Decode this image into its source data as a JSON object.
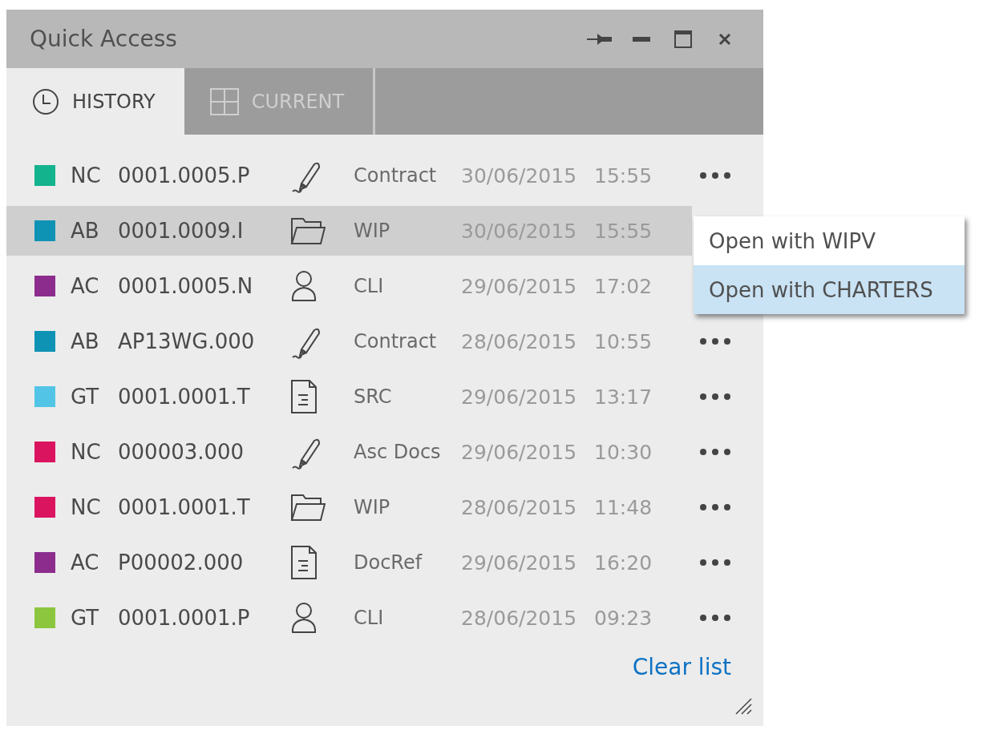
{
  "window": {
    "title": "Quick Access"
  },
  "tabs": [
    {
      "label": "HISTORY",
      "kind": "clock",
      "selected": true
    },
    {
      "label": "CURRENT",
      "kind": "grid",
      "selected": false
    }
  ],
  "rows": [
    {
      "color": "#13b38e",
      "prefix": "NC",
      "code": "0001.0005.P",
      "kind": "pen",
      "type": "Contract",
      "date": "30/06/2015",
      "time": "15:55",
      "selected": false
    },
    {
      "color": "#0f93b5",
      "prefix": "AB",
      "code": "0001.0009.I",
      "kind": "folder",
      "type": "WIP",
      "date": "30/06/2015",
      "time": "15:55",
      "selected": true
    },
    {
      "color": "#8c2d8e",
      "prefix": "AC",
      "code": "0001.0005.N",
      "kind": "person",
      "type": "CLI",
      "date": "29/06/2015",
      "time": "17:02",
      "selected": false
    },
    {
      "color": "#0f93b5",
      "prefix": "AB",
      "code": "AP13WG.000",
      "kind": "pen",
      "type": "Contract",
      "date": "28/06/2015",
      "time": "10:55",
      "selected": false
    },
    {
      "color": "#52c5e6",
      "prefix": "GT",
      "code": "0001.0001.T",
      "kind": "document",
      "type": "SRC",
      "date": "29/06/2015",
      "time": "13:17",
      "selected": false
    },
    {
      "color": "#db1460",
      "prefix": "NC",
      "code": "000003.000",
      "kind": "pen",
      "type": "Asc Docs",
      "date": "29/06/2015",
      "time": "10:30",
      "selected": false
    },
    {
      "color": "#db1460",
      "prefix": "NC",
      "code": "0001.0001.T",
      "kind": "folder",
      "type": "WIP",
      "date": "28/06/2015",
      "time": "11:48",
      "selected": false
    },
    {
      "color": "#8c2d8e",
      "prefix": "AC",
      "code": "P00002.000",
      "kind": "document",
      "type": "DocRef",
      "date": "29/06/2015",
      "time": "16:20",
      "selected": false
    },
    {
      "color": "#8cc63f",
      "prefix": "GT",
      "code": "0001.0001.P",
      "kind": "person",
      "type": "CLI",
      "date": "28/06/2015",
      "time": "09:23",
      "selected": false
    }
  ],
  "context_menu": {
    "items": [
      {
        "label": "Open with WIPV",
        "selected": false
      },
      {
        "label": "Open with CHARTERS",
        "selected": true
      }
    ]
  },
  "clear_link": "Clear list"
}
